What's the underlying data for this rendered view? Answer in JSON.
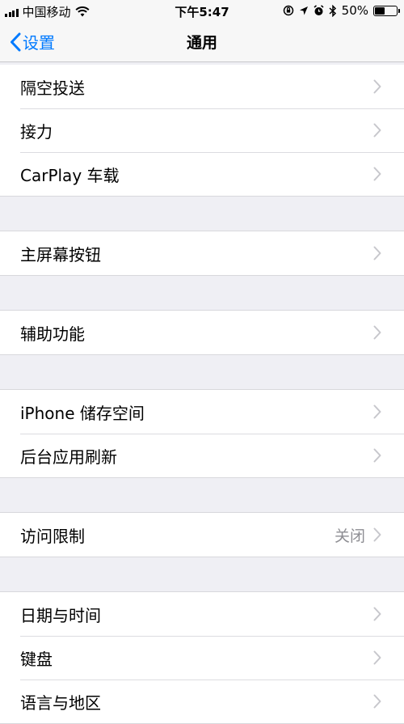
{
  "status_bar": {
    "carrier": "中国移动",
    "time": "下午5:47",
    "battery": "50%",
    "battery_level": 0.5
  },
  "nav": {
    "back_label": "设置",
    "title": "通用"
  },
  "groups": [
    {
      "items": [
        {
          "label": "隔空投送"
        },
        {
          "label": "接力"
        },
        {
          "label": "CarPlay 车载"
        }
      ]
    },
    {
      "items": [
        {
          "label": "主屏幕按钮"
        }
      ]
    },
    {
      "items": [
        {
          "label": "辅助功能"
        }
      ]
    },
    {
      "items": [
        {
          "label": "iPhone 储存空间"
        },
        {
          "label": "后台应用刷新"
        }
      ]
    },
    {
      "items": [
        {
          "label": "访问限制",
          "value": "关闭"
        }
      ]
    },
    {
      "items": [
        {
          "label": "日期与时间"
        },
        {
          "label": "键盘"
        },
        {
          "label": "语言与地区"
        }
      ]
    }
  ],
  "colors": {
    "accent": "#007aff",
    "background": "#efeff4",
    "secondary_text": "#8e8e93",
    "chevron": "#c7c7cc"
  },
  "icons": [
    "signal-icon",
    "wifi-icon",
    "orientation-lock-icon",
    "location-icon",
    "alarm-icon",
    "bluetooth-icon",
    "battery-icon",
    "back-chevron-icon",
    "chevron-right-icon"
  ]
}
